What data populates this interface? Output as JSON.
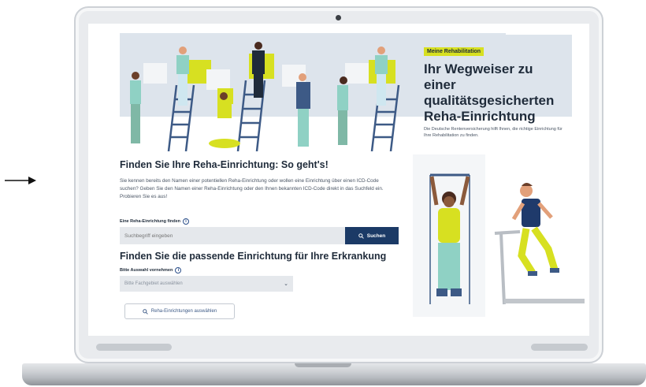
{
  "hero": {
    "badge": "Meine Rehabilitation",
    "title": "Ihr Wegweiser zu einer qualitätsgesicherten Reha-Einrichtung",
    "description": "Die Deutsche Rentenversicherung hilft Ihnen, die richtige Einrichtung für Ihre Rehabilitation zu finden."
  },
  "finder": {
    "title": "Finden Sie Ihre Reha-Einrichtung: So geht's!",
    "intro": "Sie kennen bereits den Namen einer potentiellen Reha-Einrichtung oder wollen eine Einrichtung über einen ICD-Code suchen? Geben Sie den Namen einer Reha-Einrichtung oder den Ihnen bekannten ICD-Code direkt in das Suchfeld ein. Probieren Sie es aus!",
    "search_label": "Eine Reha-Einrichtung finden",
    "search_placeholder": "Suchbegriff eingeben",
    "search_button": "Suchen"
  },
  "disease": {
    "title": "Finden Sie die passende Einrichtung für Ihre Erkrankung",
    "select_label": "Bitte Auswahl vornehmen",
    "select_value": "Bitte Fachgebiet auswählen",
    "choose_button": "Reha-Einrichtungen auswählen"
  },
  "colors": {
    "navy": "#1b3a66",
    "accent_yellow": "#d7e021",
    "hero_background": "#dde4ec",
    "input_background": "#e5e8ec"
  },
  "icons": {
    "info": "info-icon",
    "search": "search-icon",
    "chevron": "chevron-down-icon",
    "camera": "camera-icon",
    "arrow": "arrow-right-icon"
  }
}
